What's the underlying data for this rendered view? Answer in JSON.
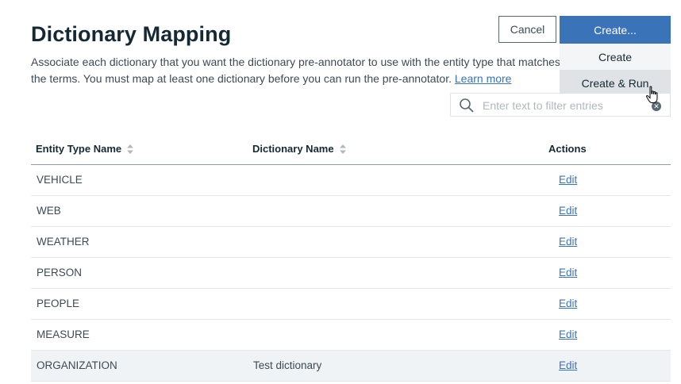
{
  "header": {
    "title": "Dictionary Mapping",
    "description": "Associate each dictionary that you want the dictionary pre-annotator to use with the entity type that matches the terms. You must map at least one dictionary before you can run the pre-annotator.",
    "learn_more": "Learn more"
  },
  "buttons": {
    "cancel": "Cancel",
    "create": "Create..."
  },
  "create_menu": {
    "items": [
      "Create",
      "Create & Run"
    ],
    "hovered": "Create & Run"
  },
  "search": {
    "placeholder": "Enter text to filter entries",
    "value": ""
  },
  "table": {
    "columns": [
      "Entity Type Name",
      "Dictionary Name",
      "Actions"
    ],
    "rows": [
      {
        "entity": "VEHICLE",
        "dictionary": "",
        "action": "Edit"
      },
      {
        "entity": "WEB",
        "dictionary": "",
        "action": "Edit"
      },
      {
        "entity": "WEATHER",
        "dictionary": "",
        "action": "Edit"
      },
      {
        "entity": "PERSON",
        "dictionary": "",
        "action": "Edit"
      },
      {
        "entity": "PEOPLE",
        "dictionary": "",
        "action": "Edit"
      },
      {
        "entity": "MEASURE",
        "dictionary": "",
        "action": "Edit"
      },
      {
        "entity": "ORGANIZATION",
        "dictionary": "Test dictionary",
        "action": "Edit"
      }
    ]
  },
  "colors": {
    "accent": "#3b73b9",
    "title": "#152935",
    "highlight_row": "#f0f3f5"
  }
}
